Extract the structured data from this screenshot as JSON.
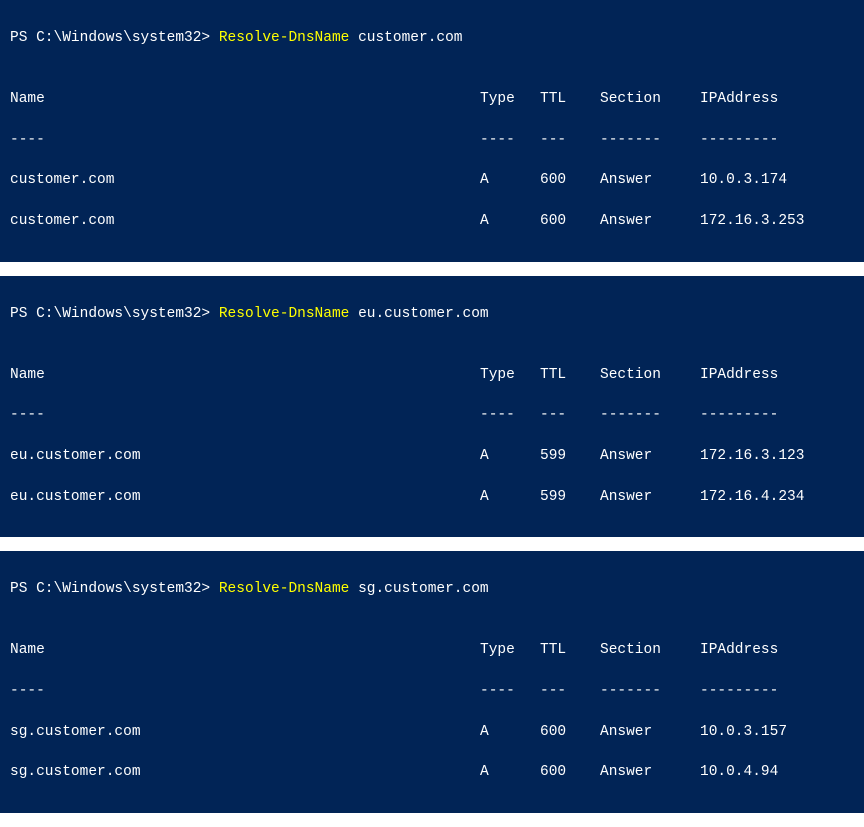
{
  "blocks": [
    {
      "prompt": "PS C:\\Windows\\system32> ",
      "command": "Resolve-DnsName",
      "argument": "customer.com",
      "headers": {
        "name": "Name",
        "type": "Type",
        "ttl": "TTL",
        "section": "Section",
        "ip": "IPAddress"
      },
      "separators": {
        "name": "----",
        "type": "----",
        "ttl": "---",
        "section": "-------",
        "ip": "---------"
      },
      "rows": [
        {
          "name": "customer.com",
          "type": "A",
          "ttl": "600",
          "section": "Answer",
          "ip": "10.0.3.174"
        },
        {
          "name": "customer.com",
          "type": "A",
          "ttl": "600",
          "section": "Answer",
          "ip": "172.16.3.253"
        }
      ]
    },
    {
      "prompt": "PS C:\\Windows\\system32> ",
      "command": "Resolve-DnsName",
      "argument": "eu.customer.com",
      "headers": {
        "name": "Name",
        "type": "Type",
        "ttl": "TTL",
        "section": "Section",
        "ip": "IPAddress"
      },
      "separators": {
        "name": "----",
        "type": "----",
        "ttl": "---",
        "section": "-------",
        "ip": "---------"
      },
      "rows": [
        {
          "name": "eu.customer.com",
          "type": "A",
          "ttl": "599",
          "section": "Answer",
          "ip": "172.16.3.123"
        },
        {
          "name": "eu.customer.com",
          "type": "A",
          "ttl": "599",
          "section": "Answer",
          "ip": "172.16.4.234"
        }
      ]
    },
    {
      "prompt": "PS C:\\Windows\\system32> ",
      "command": "Resolve-DnsName",
      "argument": "sg.customer.com",
      "headers": {
        "name": "Name",
        "type": "Type",
        "ttl": "TTL",
        "section": "Section",
        "ip": "IPAddress"
      },
      "separators": {
        "name": "----",
        "type": "----",
        "ttl": "---",
        "section": "-------",
        "ip": "---------"
      },
      "rows": [
        {
          "name": "sg.customer.com",
          "type": "A",
          "ttl": "600",
          "section": "Answer",
          "ip": "10.0.3.157"
        },
        {
          "name": "sg.customer.com",
          "type": "A",
          "ttl": "600",
          "section": "Answer",
          "ip": "10.0.4.94"
        }
      ]
    }
  ]
}
